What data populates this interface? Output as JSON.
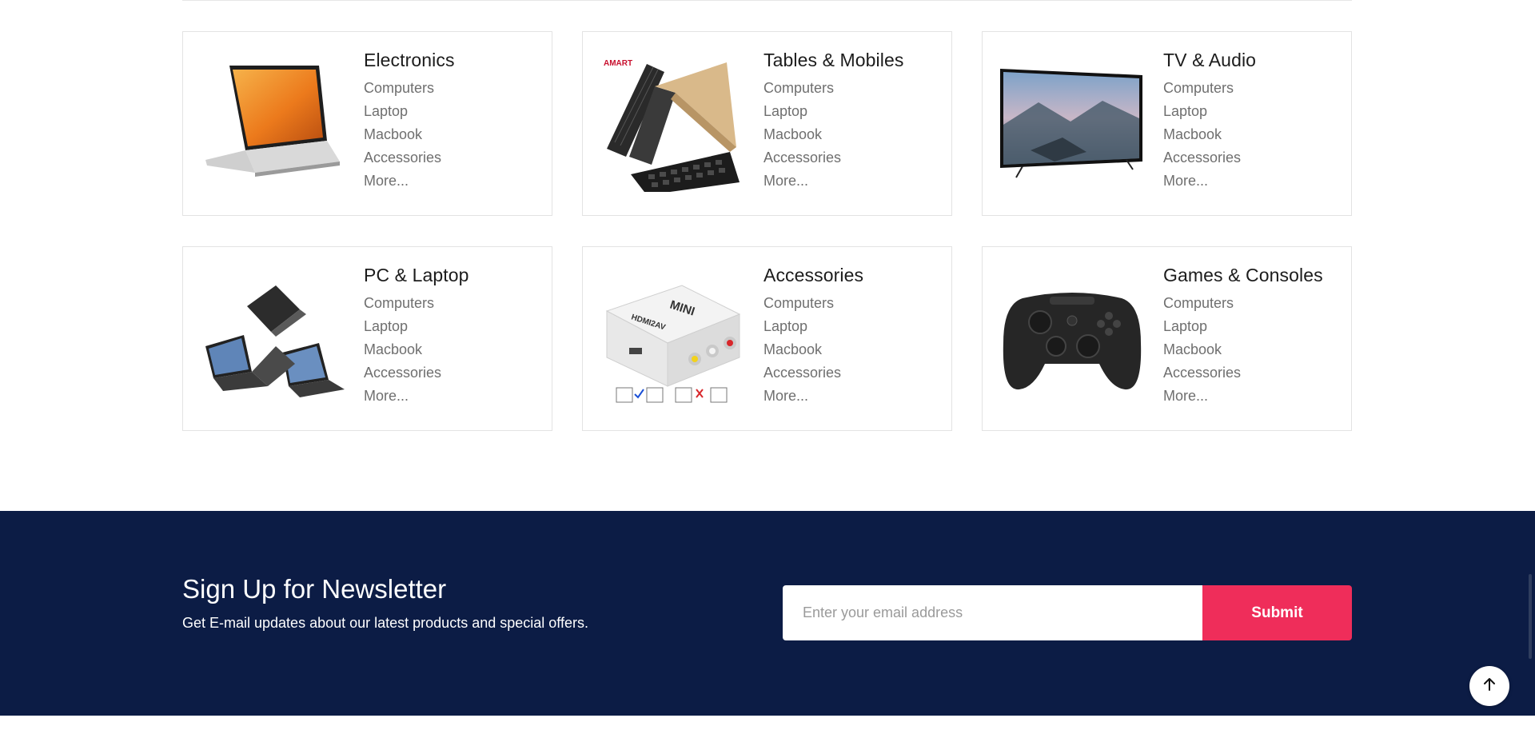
{
  "categories": [
    {
      "title": "Electronics",
      "icon": "laptop-image",
      "links": [
        "Computers",
        "Laptop",
        "Macbook",
        "Accessories",
        "More..."
      ]
    },
    {
      "title": "Tables & Mobiles",
      "icon": "tablet-keyboard-image",
      "brand_mark": "AMART",
      "links": [
        "Computers",
        "Laptop",
        "Macbook",
        "Accessories",
        "More..."
      ]
    },
    {
      "title": "TV & Audio",
      "icon": "tv-image",
      "links": [
        "Computers",
        "Laptop",
        "Macbook",
        "Accessories",
        "More..."
      ]
    },
    {
      "title": "PC & Laptop",
      "icon": "laptops-image",
      "links": [
        "Computers",
        "Laptop",
        "Macbook",
        "Accessories",
        "More..."
      ]
    },
    {
      "title": "Accessories",
      "icon": "hdmi-adapter-image",
      "product_label": "MINI",
      "product_sublabel": "HDMI2AV",
      "links": [
        "Computers",
        "Laptop",
        "Macbook",
        "Accessories",
        "More..."
      ]
    },
    {
      "title": "Games & Consoles",
      "icon": "gamepad-image",
      "links": [
        "Computers",
        "Laptop",
        "Macbook",
        "Accessories",
        "More..."
      ]
    }
  ],
  "newsletter": {
    "title": "Sign Up for Newsletter",
    "subtitle": "Get E-mail updates about our latest products and special offers.",
    "email_placeholder": "Enter your email address",
    "submit_label": "Submit"
  },
  "scroll_top_icon": "arrow-up-icon",
  "colors": {
    "newsletter_bg": "#0c1c45",
    "accent": "#ef2d5a",
    "card_border": "#e3e3e3",
    "link_text": "#6f6f6f"
  }
}
